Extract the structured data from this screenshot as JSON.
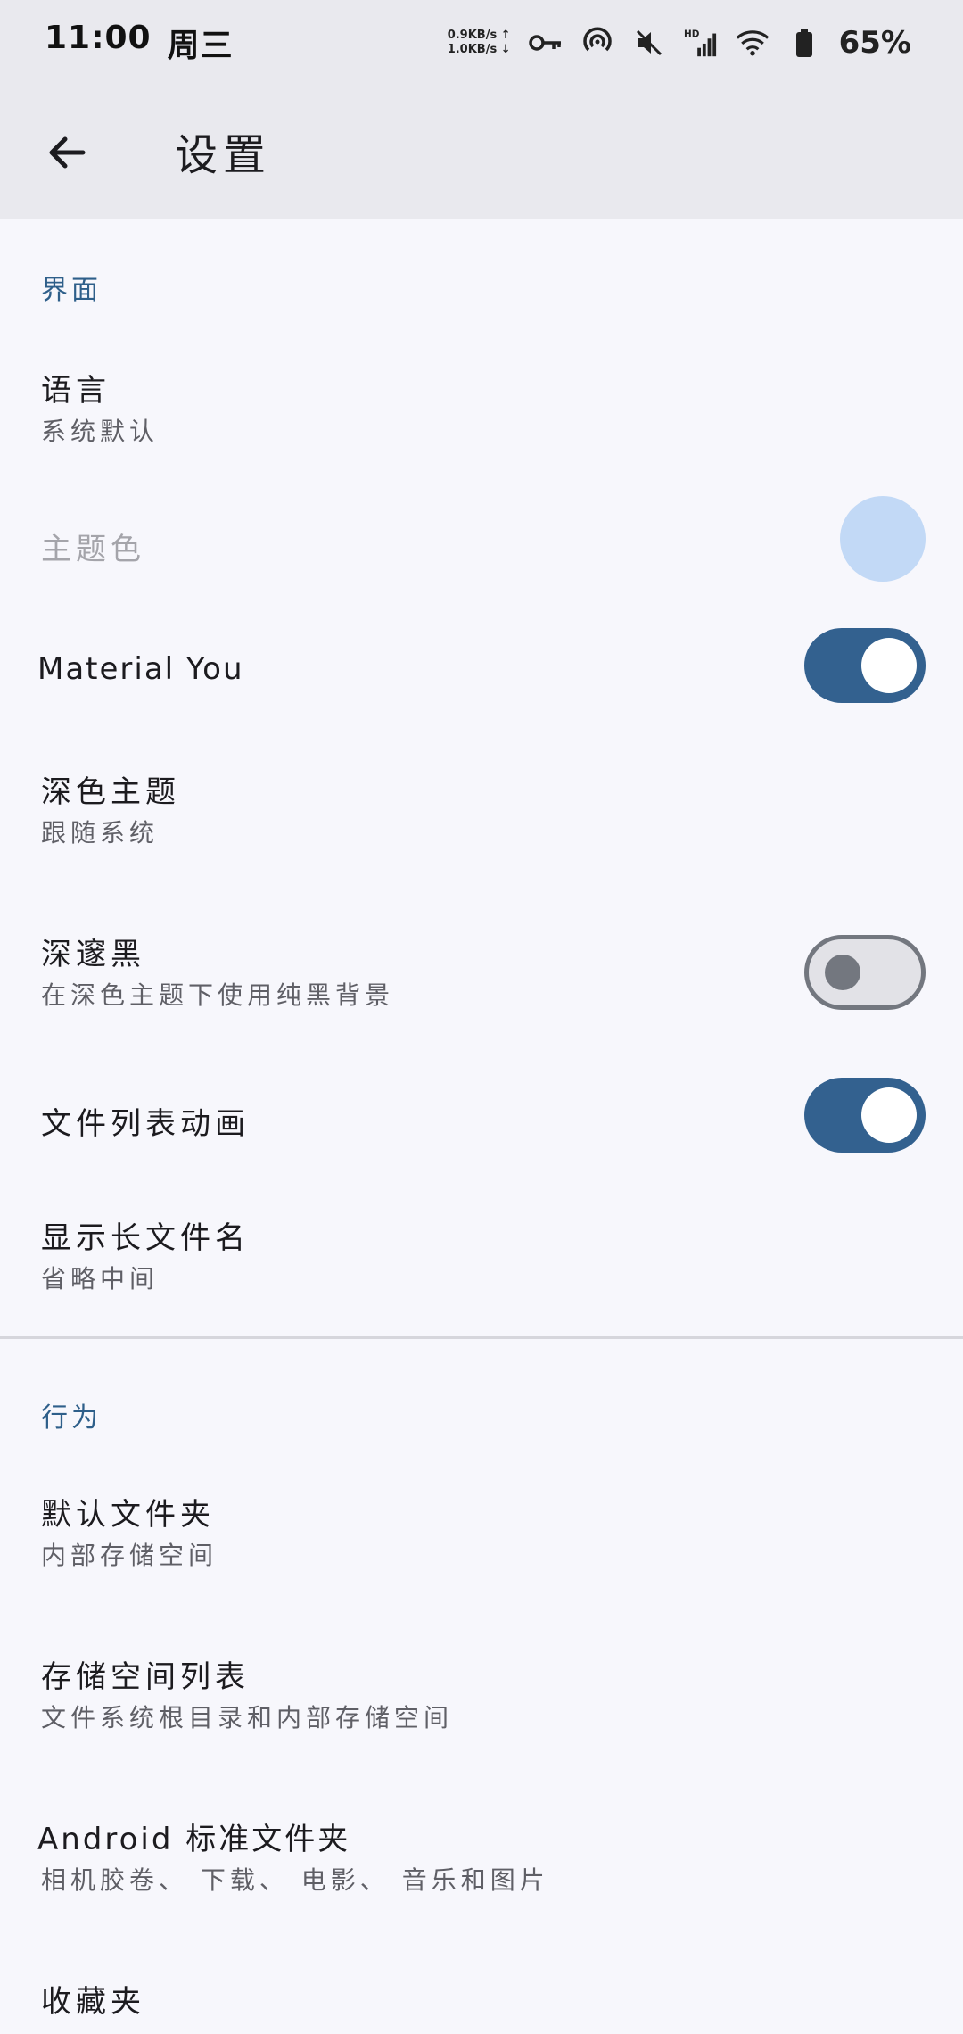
{
  "status_bar": {
    "time": "11:00",
    "day": "周三",
    "net_up": "0.9KB/s ↑",
    "net_down": "1.0KB/s ↓",
    "battery": "65%",
    "icons": [
      "key-icon",
      "hotspot-icon",
      "mute-icon",
      "hd-signal-icon",
      "wifi-icon",
      "battery-icon"
    ]
  },
  "app_bar": {
    "title": "设置",
    "back_icon": "arrow-back-icon"
  },
  "colors": {
    "accent": "#33618f",
    "section": "#2e5f8a",
    "theme_color": "#c2d9f6"
  },
  "sections": {
    "interface": {
      "header": "界面",
      "language": {
        "title": "语言",
        "summary": "系统默认"
      },
      "theme_color": {
        "title": "主题色"
      },
      "material_you": {
        "title": "Material You",
        "checked": true
      },
      "dark_theme": {
        "title": "深色主题",
        "summary": "跟随系统"
      },
      "black_night": {
        "title": "深邃黑",
        "summary": "在深色主题下使用纯黑背景",
        "checked": false
      },
      "file_list_animation": {
        "title": "文件列表动画",
        "checked": true
      },
      "long_file_name": {
        "title": "显示长文件名",
        "summary": "省略中间"
      }
    },
    "behavior": {
      "header": "行为",
      "default_folder": {
        "title": "默认文件夹",
        "summary": "内部存储空间"
      },
      "storage_list": {
        "title": "存储空间列表",
        "summary": "文件系统根目录和内部存储空间"
      },
      "standard_folders": {
        "title": "Android 标准文件夹",
        "summary": "相机胶卷、 下载、 电影、 音乐和图片"
      },
      "bookmarks": {
        "title": "收藏夹"
      }
    }
  }
}
